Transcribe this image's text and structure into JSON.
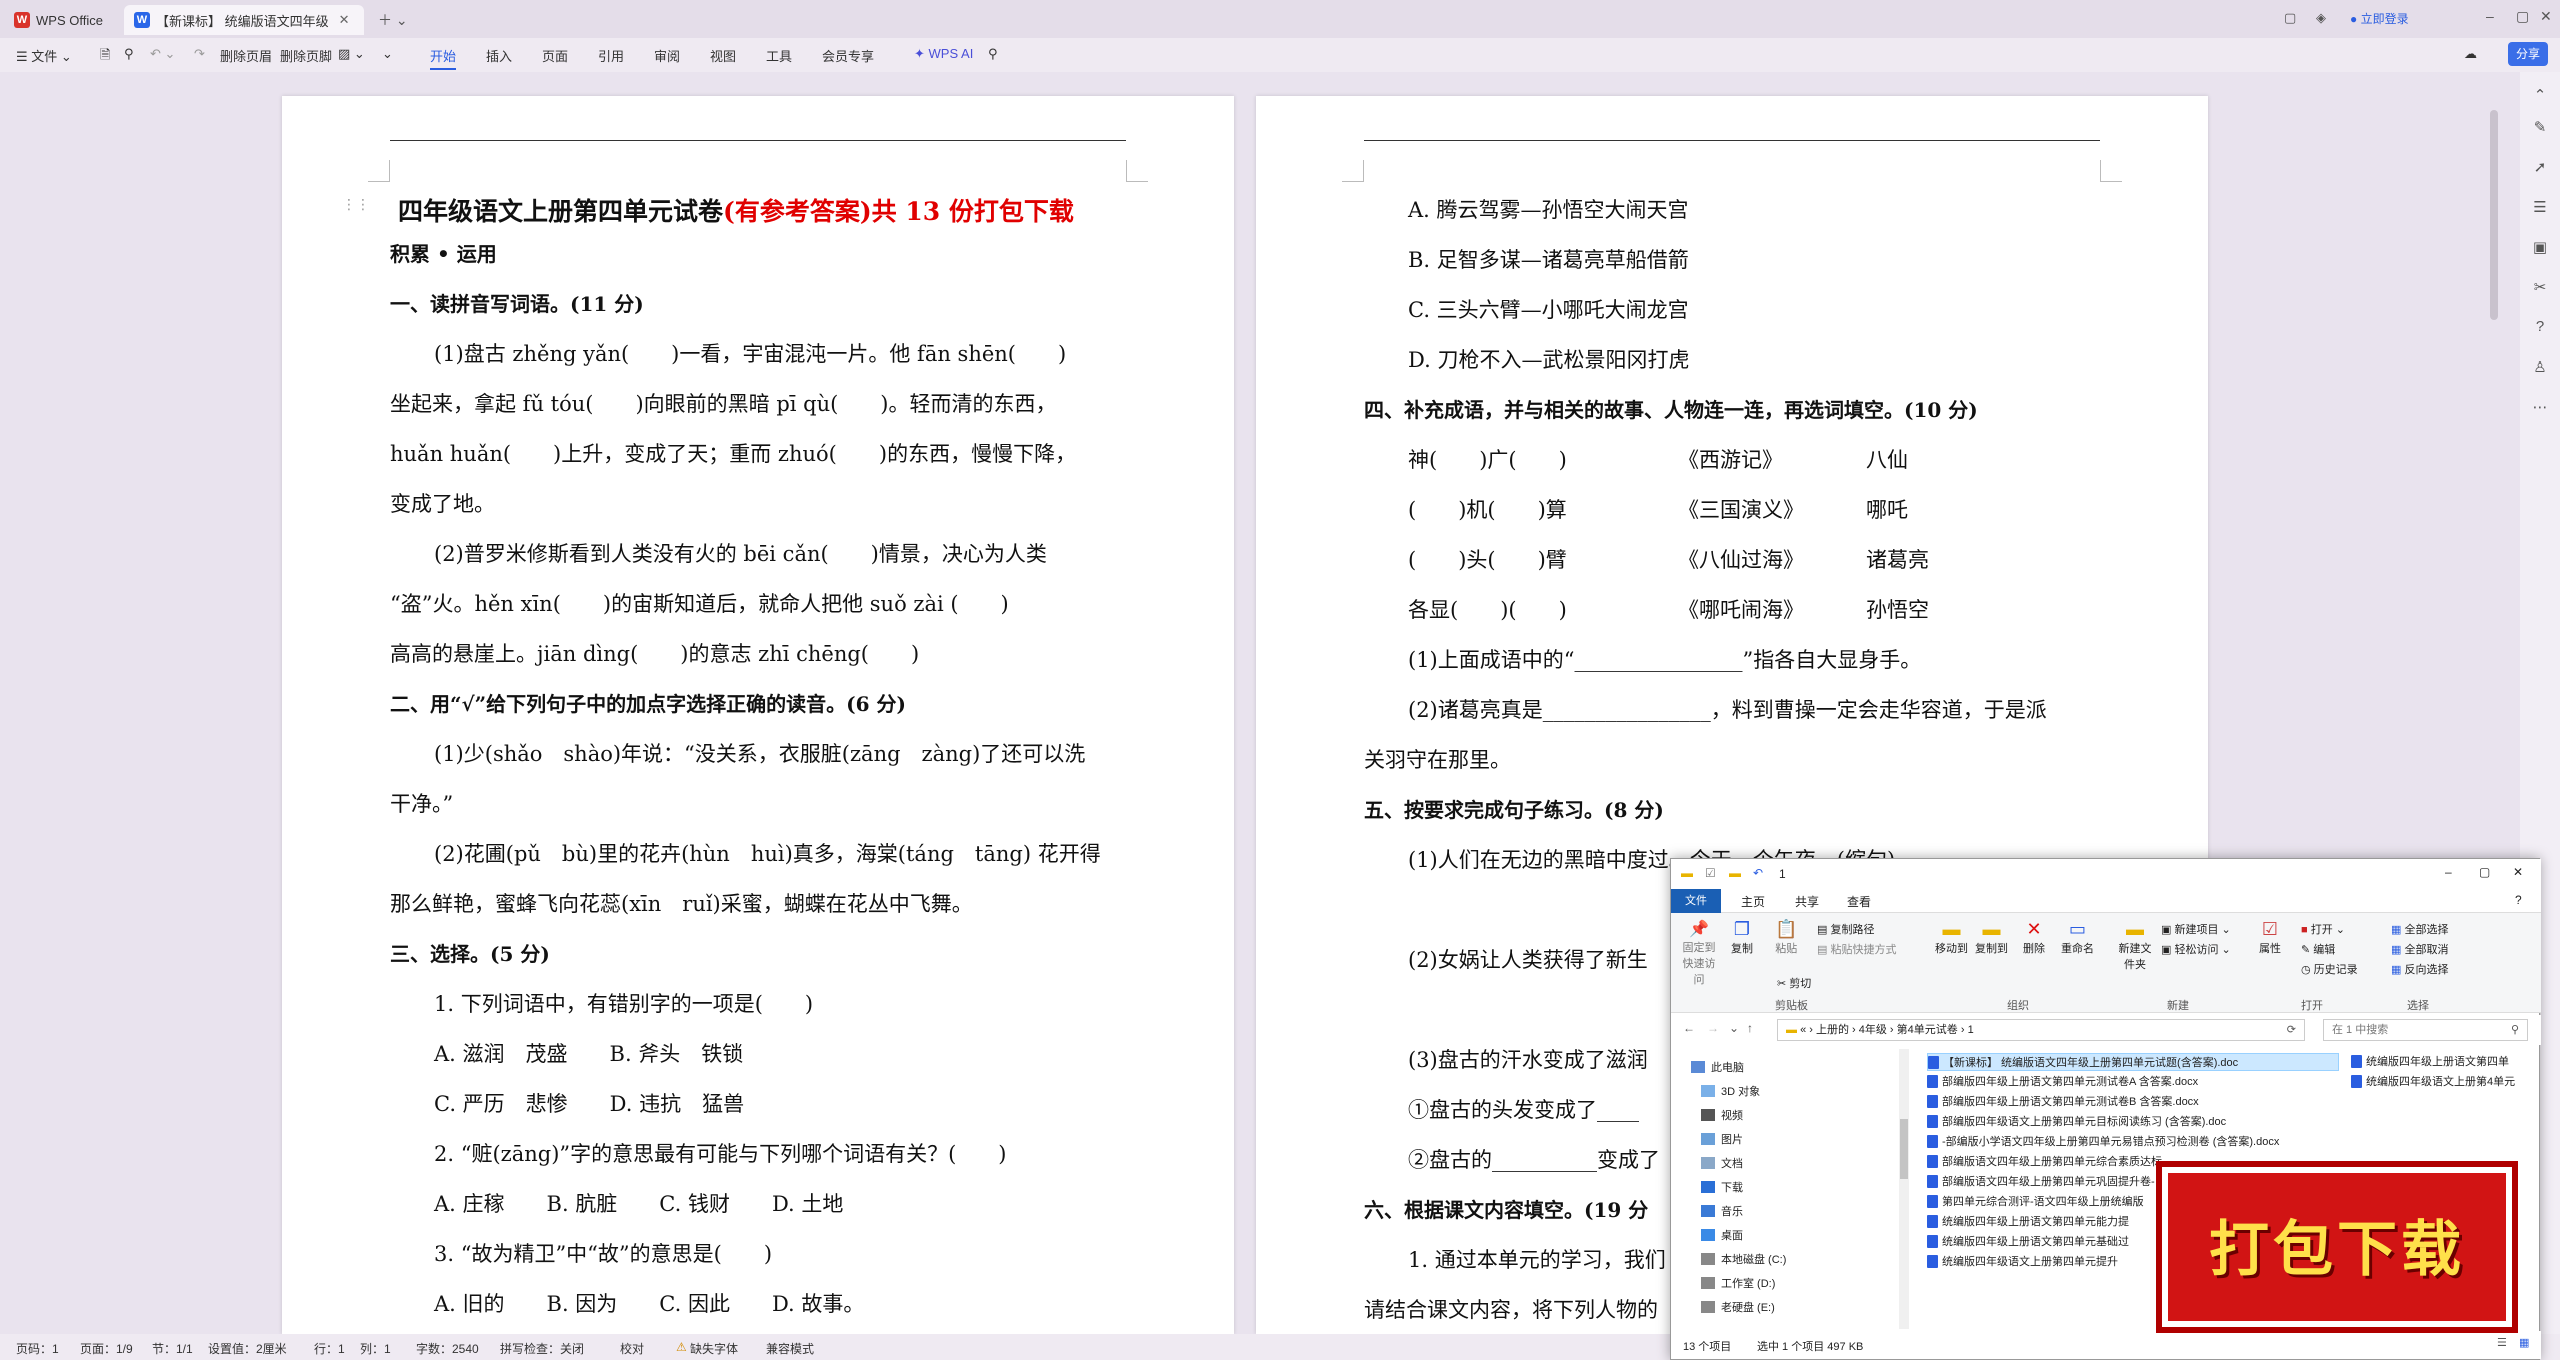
{
  "titlebar": {
    "app_tab": "WPS Office",
    "doc_tab": "【新课标】 统编版语文四年级",
    "login": "立即登录"
  },
  "toolbar": {
    "file": "文件",
    "delete_header": "删除页眉",
    "delete_footer": "删除页脚",
    "menus": [
      "开始",
      "插入",
      "页面",
      "引用",
      "审阅",
      "视图",
      "工具",
      "会员专享"
    ],
    "wps_ai": "WPS AI",
    "share": "分享"
  },
  "left_page": {
    "title_black": "四年级语文上册第四单元试卷",
    "title_red": "(有参考答案)共 13 份打包下载",
    "lines": [
      "积累 • 运用",
      "一、读拼音写词语。(11 分)",
      "(1)盘古 zhěng yǎn(　　)一看，宇宙混沌一片。他 fān shēn(　　)",
      "坐起来，拿起 fǔ tóu(　　)向眼前的黑暗 pī  qù(　　)。轻而清的东西，",
      "huǎn huǎn(　　)上升，变成了天；重而 zhuó(　　)的东西，慢慢下降，",
      "变成了地。",
      "(2)普罗米修斯看到人类没有火的 bēi  cǎn(　　)情景，决心为人类",
      "“盗”火。hěn  xīn(　　)的宙斯知道后，就命人把他 suǒ  zài (　　)",
      "高高的悬崖上。jiān  dìng(　　)的意志 zhī  chēng(　　)",
      "二、用“√”给下列句子中的加点字选择正确的读音。(6 分)",
      "(1)少(shǎo　shào)年说：“没关系，衣服脏(zāng　zàng)了还可以洗",
      "干净。”",
      "(2)花圃(pǔ　bù)里的花卉(hùn　huì)真多，海棠(táng　tāng) 花开得",
      "那么鲜艳，蜜蜂飞向花蕊(xīn　ruǐ)采蜜，蝴蝶在花丛中飞舞。",
      "三、选择。(5 分)",
      "1. 下列词语中，有错别字的一项是(　　)",
      "A. 滋润　茂盛　　B. 斧头　铁锁",
      "C. 严历　悲惨　　D. 违抗　猛兽",
      "2. “赃(zāng)”字的意思最有可能与下列哪个词语有关？(　　)",
      "A. 庄稼　　B. 肮脏　　C. 钱财　　D. 土地",
      "3. “故为精卫”中“故”的意思是(　　)",
      "A. 旧的　　B. 因为　　C. 因此　　D. 故事。"
    ]
  },
  "right_page": {
    "lines": [
      "A. 腾云驾雾—孙悟空大闹天宫",
      "B. 足智多谋—诸葛亮草船借箭",
      "C. 三头六臂—小哪吒大闹龙宫",
      "D. 刀枪不入—武松景阳冈打虎",
      "四、补充成语，并与相关的故事、人物连一连，再选词填空。(10 分)",
      "神(　　)广(　　)",
      "(　　)机(　　)算",
      "(　　)头(　　)臂",
      "各显(　　)(　　)",
      "《西游记》",
      "《三国演义》",
      "《八仙过海》",
      "《哪吒闹海》",
      "八仙",
      "哪吒",
      "诸葛亮",
      "孙悟空",
      "(1)上面成语中的“________________”指各自大显身手。",
      "(2)诸葛亮真是________________，料到曹操一定会走华容道，于是派",
      "关羽守在那里。",
      "五、按要求完成句子练习。(8 分)",
      "(1)人们在无边的黑暗中度过。今天一个午夜。(缩句)",
      "(2)女娲让人类获得了新生",
      "(3)盘古的汗水变成了滋润",
      "①盘古的头发变成了____",
      "②盘古的__________变成了",
      "六、根据课文内容填空。(19 分",
      "1. 通过本单元的学习，我们",
      "请结合课文内容，将下列人物的"
    ]
  },
  "explorer": {
    "title": "1",
    "tabs": [
      "文件",
      "主页",
      "共享",
      "查看"
    ],
    "ribbon": {
      "pin": "固定到快速访问",
      "copy": "复制",
      "paste": "粘贴",
      "copy_path": "复制路径",
      "paste_shortcut": "粘贴快捷方式",
      "cut": "剪切",
      "clipboard": "剪贴板",
      "move_to": "移动到",
      "copy_to": "复制到",
      "delete": "删除",
      "rename": "重命名",
      "organize": "组织",
      "new_folder": "新建文件夹",
      "new_item": "新建项目",
      "easy_access": "轻松访问",
      "new": "新建",
      "properties": "属性",
      "open": "打开",
      "edit": "编辑",
      "history": "历史记录",
      "open_group": "打开",
      "select_all": "全部选择",
      "select_none": "全部取消",
      "invert": "反向选择",
      "select": "选择"
    },
    "path": [
      "«",
      "上册的",
      "4年级",
      "第4单元试卷",
      "1"
    ],
    "search": "在 1 中搜索",
    "nav": [
      "此电脑",
      "3D 对象",
      "视频",
      "图片",
      "文档",
      "下载",
      "音乐",
      "桌面",
      "本地磁盘 (C:)",
      "工作室 (D:)",
      "老硬盘 (E:)"
    ],
    "files": [
      "【新课标】 统编版语文四年级上册第四单元试题(含答案).doc",
      "部编版四年级上册语文第四单元测试卷A  含答案.docx",
      "部编版四年级上册语文第四单元测试卷B  含答案.docx",
      "部编版四年级语文上册第四单元目标阅读练习 (含答案).doc",
      "-部编版小学语文四年级上册第四单元易错点预习检测卷 (含答案).docx",
      "部编版语文四年级上册第四单元综合素质达标",
      "部编版语文四年级上册第四单元巩固提升卷-",
      "第四单元综合测评-语文四年级上册统编版",
      "统编版四年级上册语文第四单元能力提",
      "统编版四年级上册语文第四单元基础过",
      "统编版四年级语文上册第四单元提升"
    ],
    "files_col2": [
      "统编版四年级上册语文第四单",
      "统编版四年级语文上册第4单元"
    ],
    "status_count": "13 个项目",
    "status_sel": "选中 1 个项目  497 KB"
  },
  "banner": "打包下载",
  "statusbar": [
    "页码：1",
    "页面：1/9",
    "节：1/1",
    "设置值：2厘米",
    "行：1",
    "列：1",
    "字数：2540",
    "拼写检查：关闭",
    "校对",
    "缺失字体",
    "兼容模式"
  ]
}
